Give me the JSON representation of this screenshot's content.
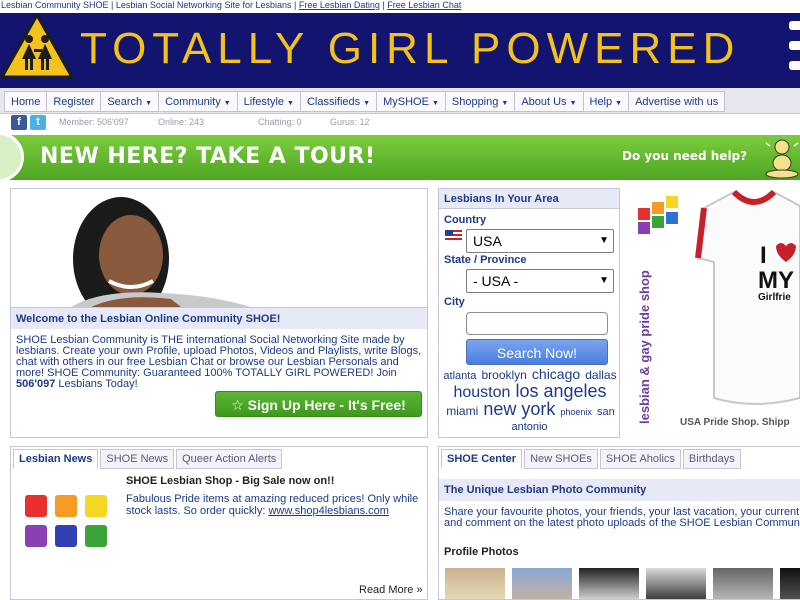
{
  "topline": {
    "text": "Lesbian Community SHOE | Lesbian Social Networking Site for Lesbians |",
    "sep": "|",
    "link1": "Free Lesbian Dating",
    "link2": "Free Lesbian Chat"
  },
  "header": {
    "title": "TOTALLY GIRL POWERED"
  },
  "nav": [
    {
      "label": "Home",
      "dropdown": false
    },
    {
      "label": "Register",
      "dropdown": false
    },
    {
      "label": "Search",
      "dropdown": true
    },
    {
      "label": "Community",
      "dropdown": true
    },
    {
      "label": "Lifestyle",
      "dropdown": true
    },
    {
      "label": "Classifieds",
      "dropdown": true
    },
    {
      "label": "MySHOE",
      "dropdown": true
    },
    {
      "label": "Shopping",
      "dropdown": true
    },
    {
      "label": "About Us",
      "dropdown": true
    },
    {
      "label": "Help",
      "dropdown": true
    },
    {
      "label": "Advertise with us",
      "dropdown": false
    }
  ],
  "stats": {
    "member": "Member: 506'097",
    "online": "Online: 243",
    "chatting": "Chatting: 0",
    "gurus": "Gurus: 12"
  },
  "tour": {
    "text": "NEW HERE? TAKE A TOUR!",
    "help": "Do you need help?"
  },
  "welcome": {
    "heading": "Welcome to the Lesbian Online Community SHOE!",
    "text": "SHOE Lesbian Community is THE international Social Networking Site made by lesbians. Create your own Profile, upload Photos, Videos and Playlists, write Blogs, chat with others in our free Lesbian Chat or browse our Lesbian Personals and more! SHOE Community: Guaranteed 100% TOTALLY GIRL POWERED! Join",
    "count": "506'097",
    "tail": "Lesbians Today!",
    "signup": "☆ Sign Up Here - It's Free!"
  },
  "area": {
    "title": "Lesbians In Your Area",
    "country_label": "Country",
    "country_value": "USA",
    "state_label": "State / Province",
    "state_value": "- USA -",
    "city_label": "City",
    "city_value": "",
    "search": "Search Now!",
    "tags": [
      {
        "name": "atlanta",
        "size": 11
      },
      {
        "name": "brooklyn",
        "size": 12
      },
      {
        "name": "chicago",
        "size": 14
      },
      {
        "name": "dallas",
        "size": 12
      },
      {
        "name": "houston",
        "size": 16
      },
      {
        "name": "los angeles",
        "size": 18
      },
      {
        "name": "miami",
        "size": 12
      },
      {
        "name": "new york",
        "size": 18
      },
      {
        "name": "phoenix",
        "size": 9
      },
      {
        "name": "san antonio",
        "size": 11
      }
    ]
  },
  "ad": {
    "vertical": "lesbian & gay pride shop",
    "footer": "USA Pride Shop. Shipp"
  },
  "news": {
    "tabs": [
      "Lesbian News",
      "SHOE News",
      "Queer Action Alerts"
    ],
    "title": "SHOE Lesbian Shop - Big Sale now on!!",
    "text": "Fabulous Pride items at amazing reduced prices! Only while stock lasts. So order quickly:",
    "link": "www.shop4lesbians.com",
    "read_more": "Read More »"
  },
  "center": {
    "tabs": [
      "SHOE Center",
      "New SHOEs",
      "SHOE Aholics",
      "Birthdays"
    ],
    "heading": "The Unique Lesbian Photo Community",
    "line1": "Share your favourite photos, your friends, your last vacation, your current",
    "line2": "and comment on the latest photo uploads of the SHOE Lesbian Community",
    "profile_label": "Profile Photos"
  }
}
